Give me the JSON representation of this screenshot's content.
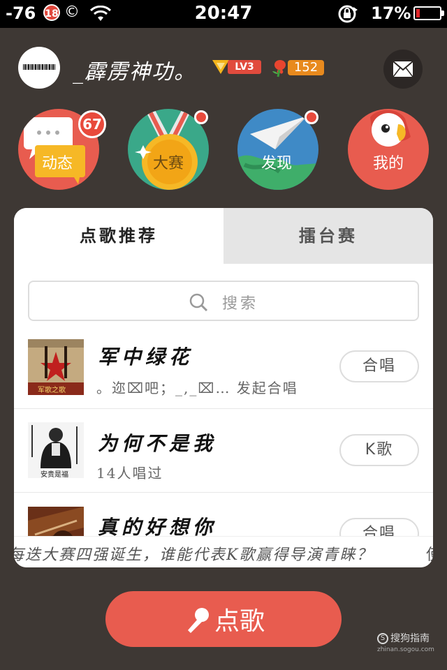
{
  "status_bar": {
    "signal": "-76",
    "badge": "18",
    "copyright_glyph": "©",
    "time": "20:47",
    "battery_pct": "17%",
    "battery_level": 0.17
  },
  "profile": {
    "username": "_霹雳神功。",
    "level": "LV3",
    "flowers": "152"
  },
  "nav": {
    "items": [
      {
        "label": "动态",
        "badge": "67"
      },
      {
        "label": "大赛"
      },
      {
        "label": "发现"
      },
      {
        "label": "我的"
      }
    ]
  },
  "tabs": {
    "active": "点歌推荐",
    "inactive": "擂台赛"
  },
  "search": {
    "placeholder": "搜索"
  },
  "songs": [
    {
      "title": "军中绿花",
      "subtitle": "。迩⌧吧；_,_⌧… 发起合唱",
      "button": "合唱",
      "cover_text": "军歌之歌"
    },
    {
      "title": "为何不是我",
      "subtitle": "14人唱过",
      "button": "K歌",
      "cover_text": "安贵是福"
    },
    {
      "title": "真的好想你",
      "subtitle": "",
      "button": "合唱"
    }
  ],
  "marquee": {
    "text": "每迭大赛四强诞生，谁能代表K歌赢得导演青睐？",
    "tail": "使"
  },
  "order_button": {
    "label": "点歌"
  },
  "watermark": {
    "main": "搜狗指南",
    "sub": "zhinan.sogou.com"
  },
  "colors": {
    "background": "#3e3834",
    "accent": "#e85c4f",
    "nav_green": "#3aa889",
    "nav_blue": "#3f8ac6"
  }
}
